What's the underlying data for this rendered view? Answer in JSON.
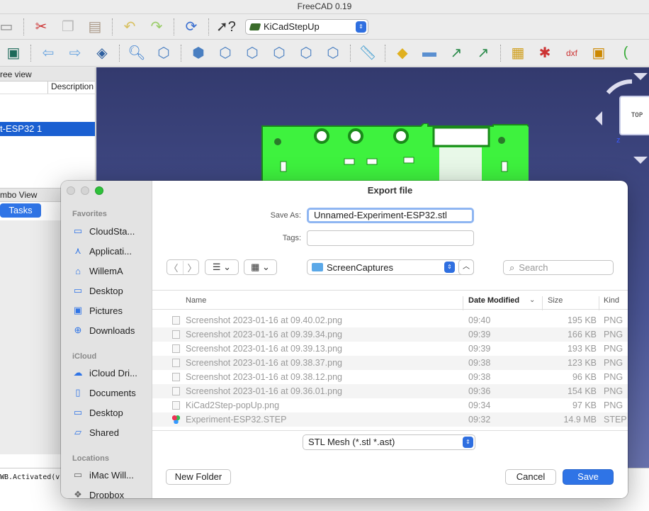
{
  "app": {
    "title": "FreeCAD 0.19",
    "workbench": "KiCadStepUp"
  },
  "panels": {
    "tree_header": "ree view",
    "col_description": "Description",
    "selected_item": "t-ESP32 1",
    "combo_view": "mbo View",
    "tasks_tab": "Tasks",
    "console_text": "WB.Activated(v"
  },
  "viewport": {
    "navcube_label": "TOP",
    "axis_label": "z"
  },
  "dialog": {
    "title": "Export file",
    "save_as_label": "Save As:",
    "save_as_value": "Unnamed-Experiment-ESP32.stl",
    "tags_label": "Tags:",
    "location": "ScreenCaptures",
    "search_placeholder": "Search",
    "sidebar": {
      "favorites_header": "Favorites",
      "favorites": [
        {
          "label": "CloudSta...",
          "icon": "folder-icon"
        },
        {
          "label": "Applicati...",
          "icon": "applications-icon"
        },
        {
          "label": "WillemA",
          "icon": "home-icon"
        },
        {
          "label": "Desktop",
          "icon": "desktop-icon"
        },
        {
          "label": "Pictures",
          "icon": "pictures-icon"
        },
        {
          "label": "Downloads",
          "icon": "downloads-icon"
        }
      ],
      "icloud_header": "iCloud",
      "icloud": [
        {
          "label": "iCloud Dri...",
          "icon": "cloud-icon"
        },
        {
          "label": "Documents",
          "icon": "document-icon"
        },
        {
          "label": "Desktop",
          "icon": "desktop-icon"
        },
        {
          "label": "Shared",
          "icon": "shared-folder-icon"
        }
      ],
      "locations_header": "Locations",
      "locations": [
        {
          "label": "iMac Will...",
          "icon": "computer-icon"
        },
        {
          "label": "Dropbox",
          "icon": "dropbox-icon"
        }
      ]
    },
    "columns": {
      "name": "Name",
      "date": "Date Modified",
      "size": "Size",
      "kind": "Kind"
    },
    "files": [
      {
        "name": "Screenshot 2023-01-16 at 09.40.02.png",
        "date": "09:40",
        "size": "195 KB",
        "kind": "PNG"
      },
      {
        "name": "Screenshot 2023-01-16 at 09.39.34.png",
        "date": "09:39",
        "size": "166 KB",
        "kind": "PNG"
      },
      {
        "name": "Screenshot 2023-01-16 at 09.39.13.png",
        "date": "09:39",
        "size": "193 KB",
        "kind": "PNG"
      },
      {
        "name": "Screenshot 2023-01-16 at 09.38.37.png",
        "date": "09:38",
        "size": "123 KB",
        "kind": "PNG"
      },
      {
        "name": "Screenshot 2023-01-16 at 09.38.12.png",
        "date": "09:38",
        "size": "96 KB",
        "kind": "PNG"
      },
      {
        "name": "Screenshot 2023-01-16 at 09.36.01.png",
        "date": "09:36",
        "size": "154 KB",
        "kind": "PNG"
      },
      {
        "name": "KiCad2Step-popUp.png",
        "date": "09:34",
        "size": "97 KB",
        "kind": "PNG"
      },
      {
        "name": "Experiment-ESP32.STEP",
        "date": "09:32",
        "size": "14.9 MB",
        "kind": "STEP"
      }
    ],
    "format": "STL Mesh (*.stl *.ast)",
    "new_folder": "New Folder",
    "cancel": "Cancel",
    "save": "Save"
  }
}
